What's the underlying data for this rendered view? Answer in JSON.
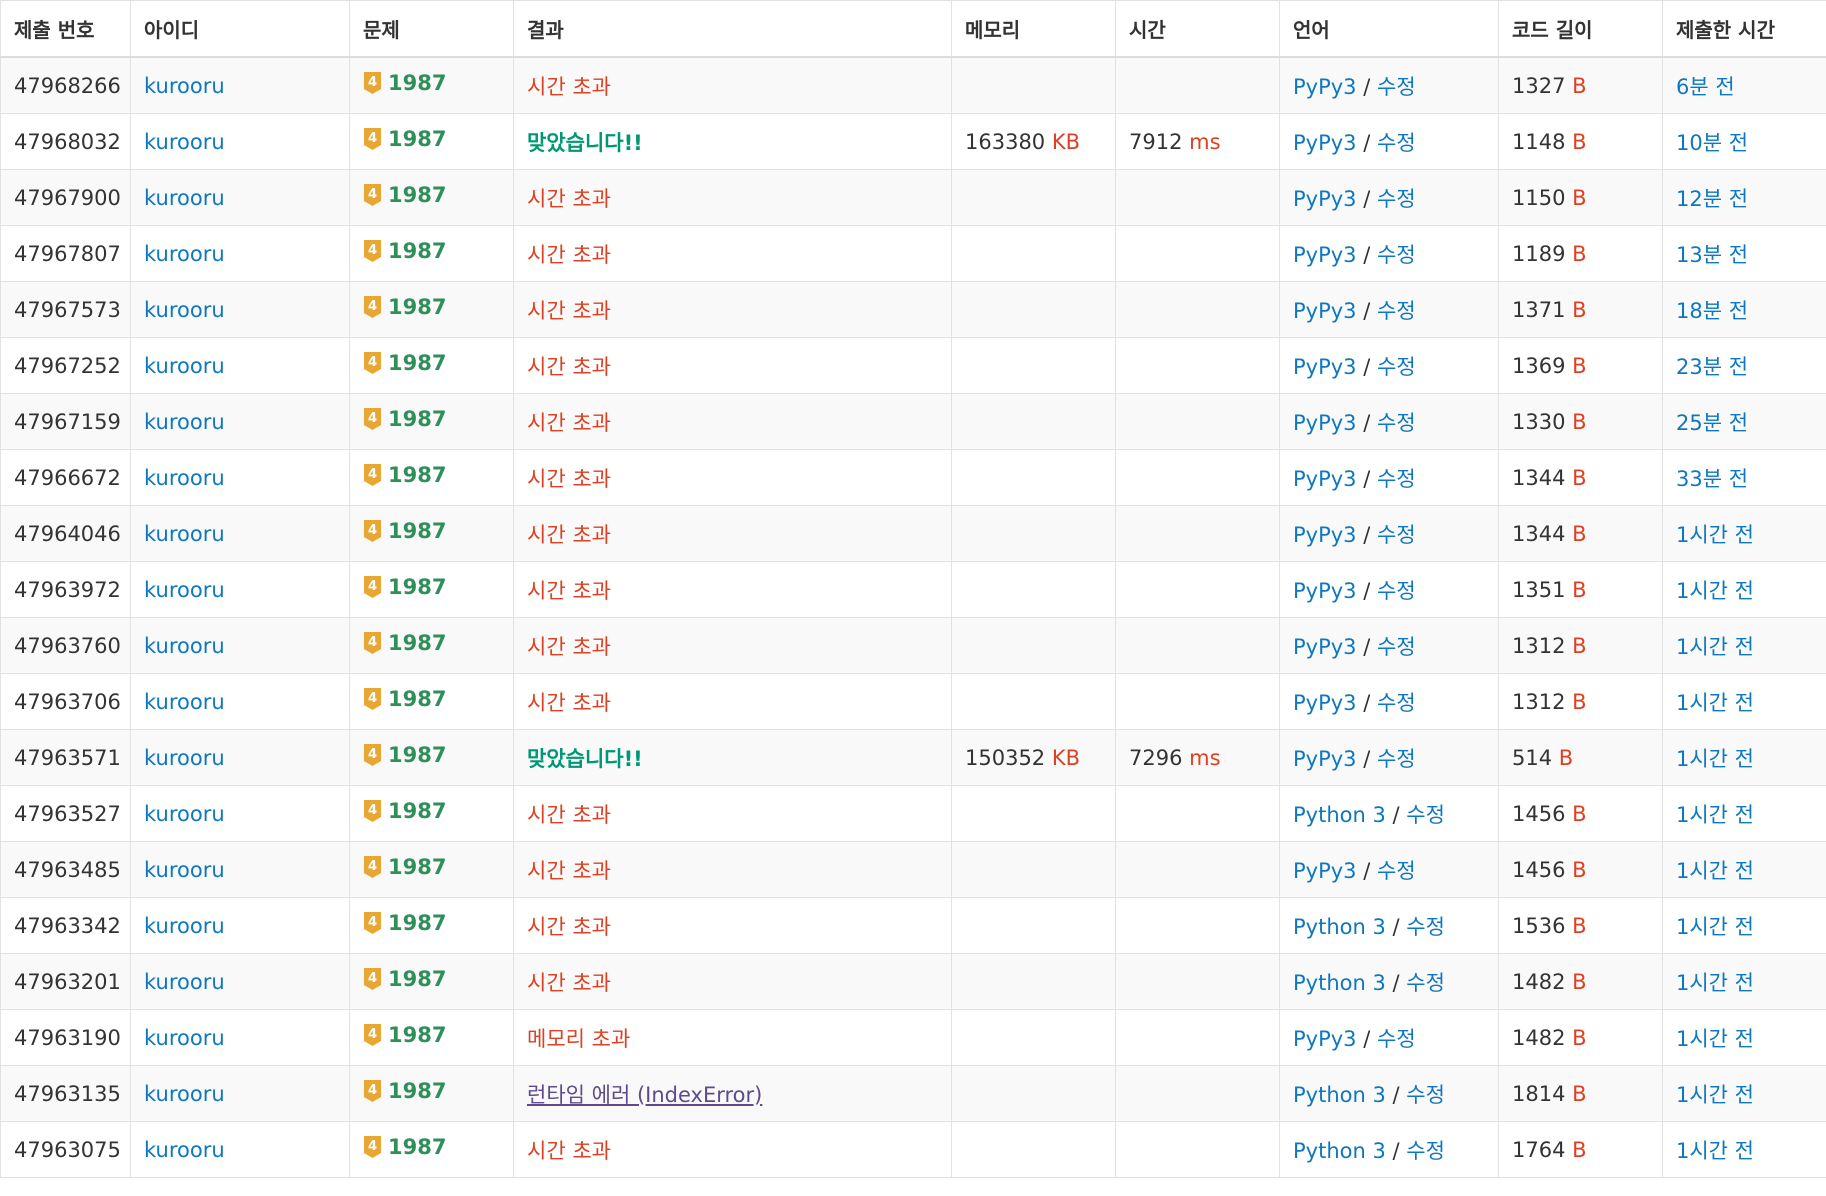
{
  "header": {
    "submission_id": "제출 번호",
    "user": "아이디",
    "problem": "문제",
    "result": "결과",
    "memory": "메모리",
    "time": "시간",
    "language": "언어",
    "code_length": "코드 길이",
    "submitted_at": "제출한 시간"
  },
  "labels": {
    "edit": "수정",
    "slash": "/",
    "tier_digit": "4",
    "memory_unit": "KB",
    "time_unit": "ms",
    "length_unit": "B"
  },
  "colors": {
    "link": "#0e77bf",
    "wrong": "#dd4124",
    "accepted": "#009874",
    "runtime_error": "#5f4b8b",
    "tier_gold": "#e8a733",
    "problem_green": "#2f8f5b"
  },
  "rows": [
    {
      "id": "47968266",
      "user": "kurooru",
      "problem": "1987",
      "result": "시간 초과",
      "result_type": "wrong",
      "memory": "",
      "time": "",
      "lang": "PyPy3",
      "length": "1327",
      "ago": "6분 전"
    },
    {
      "id": "47968032",
      "user": "kurooru",
      "problem": "1987",
      "result": "맞았습니다!!",
      "result_type": "ac",
      "memory": "163380",
      "time": "7912",
      "lang": "PyPy3",
      "length": "1148",
      "ago": "10분 전"
    },
    {
      "id": "47967900",
      "user": "kurooru",
      "problem": "1987",
      "result": "시간 초과",
      "result_type": "wrong",
      "memory": "",
      "time": "",
      "lang": "PyPy3",
      "length": "1150",
      "ago": "12분 전"
    },
    {
      "id": "47967807",
      "user": "kurooru",
      "problem": "1987",
      "result": "시간 초과",
      "result_type": "wrong",
      "memory": "",
      "time": "",
      "lang": "PyPy3",
      "length": "1189",
      "ago": "13분 전"
    },
    {
      "id": "47967573",
      "user": "kurooru",
      "problem": "1987",
      "result": "시간 초과",
      "result_type": "wrong",
      "memory": "",
      "time": "",
      "lang": "PyPy3",
      "length": "1371",
      "ago": "18분 전"
    },
    {
      "id": "47967252",
      "user": "kurooru",
      "problem": "1987",
      "result": "시간 초과",
      "result_type": "wrong",
      "memory": "",
      "time": "",
      "lang": "PyPy3",
      "length": "1369",
      "ago": "23분 전"
    },
    {
      "id": "47967159",
      "user": "kurooru",
      "problem": "1987",
      "result": "시간 초과",
      "result_type": "wrong",
      "memory": "",
      "time": "",
      "lang": "PyPy3",
      "length": "1330",
      "ago": "25분 전"
    },
    {
      "id": "47966672",
      "user": "kurooru",
      "problem": "1987",
      "result": "시간 초과",
      "result_type": "wrong",
      "memory": "",
      "time": "",
      "lang": "PyPy3",
      "length": "1344",
      "ago": "33분 전"
    },
    {
      "id": "47964046",
      "user": "kurooru",
      "problem": "1987",
      "result": "시간 초과",
      "result_type": "wrong",
      "memory": "",
      "time": "",
      "lang": "PyPy3",
      "length": "1344",
      "ago": "1시간 전"
    },
    {
      "id": "47963972",
      "user": "kurooru",
      "problem": "1987",
      "result": "시간 초과",
      "result_type": "wrong",
      "memory": "",
      "time": "",
      "lang": "PyPy3",
      "length": "1351",
      "ago": "1시간 전"
    },
    {
      "id": "47963760",
      "user": "kurooru",
      "problem": "1987",
      "result": "시간 초과",
      "result_type": "wrong",
      "memory": "",
      "time": "",
      "lang": "PyPy3",
      "length": "1312",
      "ago": "1시간 전"
    },
    {
      "id": "47963706",
      "user": "kurooru",
      "problem": "1987",
      "result": "시간 초과",
      "result_type": "wrong",
      "memory": "",
      "time": "",
      "lang": "PyPy3",
      "length": "1312",
      "ago": "1시간 전"
    },
    {
      "id": "47963571",
      "user": "kurooru",
      "problem": "1987",
      "result": "맞았습니다!!",
      "result_type": "ac",
      "memory": "150352",
      "time": "7296",
      "lang": "PyPy3",
      "length": "514",
      "ago": "1시간 전"
    },
    {
      "id": "47963527",
      "user": "kurooru",
      "problem": "1987",
      "result": "시간 초과",
      "result_type": "wrong",
      "memory": "",
      "time": "",
      "lang": "Python 3",
      "length": "1456",
      "ago": "1시간 전"
    },
    {
      "id": "47963485",
      "user": "kurooru",
      "problem": "1987",
      "result": "시간 초과",
      "result_type": "wrong",
      "memory": "",
      "time": "",
      "lang": "PyPy3",
      "length": "1456",
      "ago": "1시간 전"
    },
    {
      "id": "47963342",
      "user": "kurooru",
      "problem": "1987",
      "result": "시간 초과",
      "result_type": "wrong",
      "memory": "",
      "time": "",
      "lang": "Python 3",
      "length": "1536",
      "ago": "1시간 전"
    },
    {
      "id": "47963201",
      "user": "kurooru",
      "problem": "1987",
      "result": "시간 초과",
      "result_type": "wrong",
      "memory": "",
      "time": "",
      "lang": "Python 3",
      "length": "1482",
      "ago": "1시간 전"
    },
    {
      "id": "47963190",
      "user": "kurooru",
      "problem": "1987",
      "result": "메모리 초과",
      "result_type": "wrong",
      "memory": "",
      "time": "",
      "lang": "PyPy3",
      "length": "1482",
      "ago": "1시간 전"
    },
    {
      "id": "47963135",
      "user": "kurooru",
      "problem": "1987",
      "result": "런타임 에러 (IndexError)",
      "result_type": "rte",
      "memory": "",
      "time": "",
      "lang": "Python 3",
      "length": "1814",
      "ago": "1시간 전"
    },
    {
      "id": "47963075",
      "user": "kurooru",
      "problem": "1987",
      "result": "시간 초과",
      "result_type": "wrong",
      "memory": "",
      "time": "",
      "lang": "Python 3",
      "length": "1764",
      "ago": "1시간 전"
    }
  ]
}
